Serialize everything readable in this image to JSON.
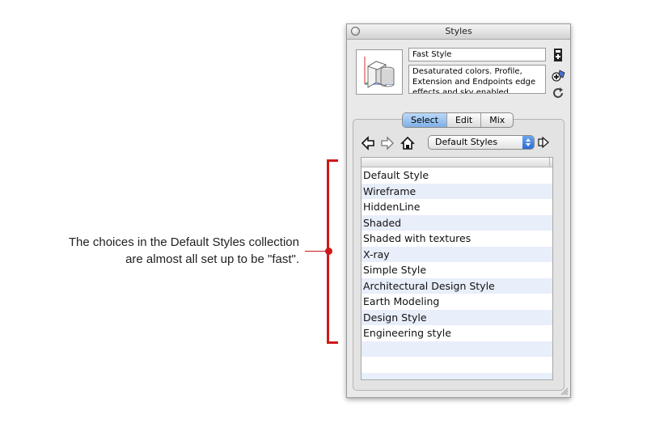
{
  "annotation": {
    "line1": "The choices in the Default Styles collection",
    "line2": "are almost all set up to be \"fast\"."
  },
  "window": {
    "title": "Styles"
  },
  "style_info": {
    "name": "Fast Style",
    "description": "Desaturated colors. Profile, Extension and Endpoints edge effects and sky enabled."
  },
  "tabs": [
    {
      "label": "Select",
      "active": true
    },
    {
      "label": "Edit",
      "active": false
    },
    {
      "label": "Mix",
      "active": false
    }
  ],
  "collection": {
    "selected": "Default Styles"
  },
  "styles_list": [
    "Default Style",
    "Wireframe",
    "HiddenLine",
    "Shaded",
    "Shaded with textures",
    "X-ray",
    "Simple Style",
    "Architectural Design Style",
    "Earth Modeling",
    "Design Style",
    "Engineering style",
    "",
    "",
    ""
  ],
  "colors": {
    "accent_red": "#d01818",
    "tab_active": "#7fb0e8",
    "row_stripe": "#e8eefa"
  }
}
